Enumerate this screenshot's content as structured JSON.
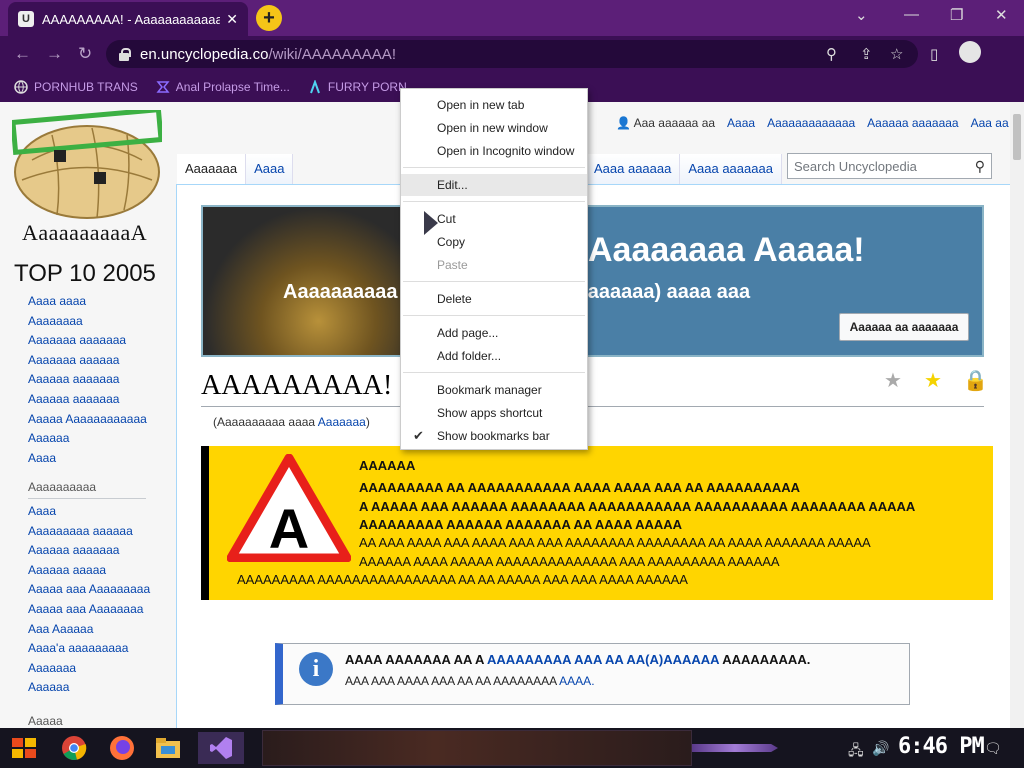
{
  "browser": {
    "tab_title": "AAAAAAAAA! - Aaaaaaaaaaaa",
    "tab_favicon": "U",
    "new_tab_label": "+",
    "url_host": "en.uncyclopedia.co",
    "url_path": "/wiki/AAAAAAAAA!",
    "bookmarks": [
      {
        "label": "PORNHUB TRANS",
        "icon": "globe-icon"
      },
      {
        "label": "Anal Prolapse Time...",
        "icon": "bookmark-icon"
      },
      {
        "label": "FURRY PORN",
        "icon": "lambda-icon"
      }
    ]
  },
  "sidebar": {
    "site_name": "AaaaaaaaaaA",
    "top10": "TOP 10 2005",
    "nav1": [
      "Aaaa aaaa",
      "Aaaaaaaa",
      "Aaaaaaa aaaaaaa",
      "Aaaaaaa aaaaaa",
      "Aaaaaa aaaaaaa",
      "Aaaaaa aaaaaaa",
      "Aaaaa Aaaaaaaaaaaa",
      "Aaaaaa",
      "Aaaa"
    ],
    "nav2_title": "Aaaaaaaaaa",
    "nav2": [
      "Aaaa",
      "Aaaaaaaaa aaaaaa",
      "Aaaaaa aaaaaaa",
      "Aaaaaa aaaaa",
      "Aaaaa aaa Aaaaaaaaa",
      "Aaaaa aaa Aaaaaaaa",
      "Aaa Aaaaaa",
      "Aaaa'a aaaaaaaaa",
      "Aaaaaaa",
      "Aaaaaa"
    ],
    "nav3_title": "Aaaaa"
  },
  "header": {
    "user_name": "Aaa aaaaaa aa",
    "user_links": [
      "Aaaa",
      "Aaaaaaaaaaaaa",
      "Aaaaaa aaaaaaa",
      "Aaa aa"
    ],
    "left_tabs": [
      "Aaaaaaa",
      "Aaaa"
    ],
    "right_tabs": [
      "Aaaa aaaaaa",
      "Aaaa aaaaaaa"
    ],
    "search_placeholder": "Search Uncyclopedia"
  },
  "banner": {
    "title": "Aaaaaaaa Aaaaa!",
    "subtitle": "Aaaaaaaaaa (aaa aaaaaaaaaaa aaaaaaa) aaaa aaa",
    "button": "Aaaaaa aa aaaaaaa"
  },
  "article": {
    "title": "AAAAAAAAA!",
    "subtitle_pre": "(Aaaaaaaaaa aaaa ",
    "subtitle_link": "Aaaaaaa",
    "subtitle_post": ")"
  },
  "warning": {
    "icon_letter": "A",
    "lines": [
      "AAAAAA",
      "AAAAAAAAA AA AAAAAAAAAAA AAAA AAAA AAA AA AAAAAAAAAA",
      "A AAAAA AAA AAAAAA AAAAAAAA AAAAAAAAAAA AAAAAAAAAA AAAAAAAA AAAAA",
      "AAAAAAAAA AAAAAA AAAAAAA AA AAAA AAAAA",
      "AA AAA AAAA AAA AAAA AAA AAA AAAAAAAA AAAAAAAA AA AAAA AAAAAAA AAAAA",
      "AAAAAA AAAA AAAAA AAAAAAAAAAAAAA AAA AAAAAAAAA AAAAAA",
      "AAAAAAAAA AAAAAAAAAAAAAAAA AA AA AAAAA AAA AAA AAAA AAAAAA"
    ]
  },
  "info": {
    "icon_letter": "i",
    "line1_pre": "AAAA AAAAAAA AA A ",
    "line1_link": "AAAAAAAAA AAA AA AA(A)AAAAAA",
    "line1_post": " AAAAAAAAA.",
    "line2_pre": "AAA AAA AAAA AAA AA AA AAAAAAAA ",
    "line2_link": "AAAA."
  },
  "context_menu": {
    "items": [
      "Open in new tab",
      "Open in new window",
      "Open in Incognito window",
      "Edit...",
      "Cut",
      "Copy",
      "Paste",
      "Delete",
      "Add page...",
      "Add folder...",
      "Bookmark manager",
      "Show apps shortcut",
      "Show bookmarks bar"
    ],
    "highlighted": "Edit...",
    "disabled": [
      "Paste"
    ],
    "checked": "Show bookmarks bar"
  },
  "taskbar": {
    "clock": "6:46 PM"
  },
  "colors": {
    "tab_bar": "#5c1f78",
    "toolbar": "#3b0f55",
    "link": "#0645ad",
    "warning_bg": "#ffd500"
  }
}
